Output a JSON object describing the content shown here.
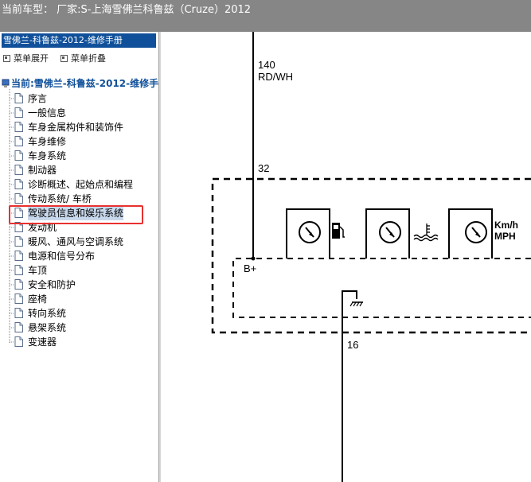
{
  "window": {
    "title": "当前车型： 厂家:S-上海雪佛兰科鲁兹（Cruze）2012"
  },
  "sidebar": {
    "header": "雪佛兰-科鲁兹-2012-维修手册",
    "expand_label": "菜单展开",
    "collapse_label": "菜单折叠",
    "root_label": "当前:雪佛兰-科鲁兹-2012-维修手册",
    "items": [
      {
        "label": "序言"
      },
      {
        "label": "一般信息"
      },
      {
        "label": "车身金属构件和装饰件"
      },
      {
        "label": "车身维修"
      },
      {
        "label": "车身系统"
      },
      {
        "label": "制动器"
      },
      {
        "label": "诊断概述、起始点和编程"
      },
      {
        "label": "传动系统/ 车桥"
      },
      {
        "label": "驾驶员信息和娱乐系统"
      },
      {
        "label": "发动机"
      },
      {
        "label": "暖风、通风与空调系统"
      },
      {
        "label": "电源和信号分布"
      },
      {
        "label": "车顶"
      },
      {
        "label": "安全和防护"
      },
      {
        "label": "座椅"
      },
      {
        "label": "转向系统"
      },
      {
        "label": "悬架系统"
      },
      {
        "label": "变速器"
      }
    ],
    "selected_index": 8
  },
  "diagram": {
    "wire_top_number": "140",
    "wire_top_color": "RD/WH",
    "connector_pin_top": "32",
    "power_label": "B+",
    "speed_units_line1": "Km/h",
    "speed_units_line2": "MPH",
    "connector_pin_bottom": "16",
    "gauges": [
      "fuel-gauge",
      "coolant-temperature-gauge",
      "speedometer"
    ]
  },
  "colors": {
    "title_bar": "#868686",
    "sidebar_header": "#10509a",
    "highlight_box": "#e8312f",
    "selected_item_bg": "#c8d8ec"
  }
}
